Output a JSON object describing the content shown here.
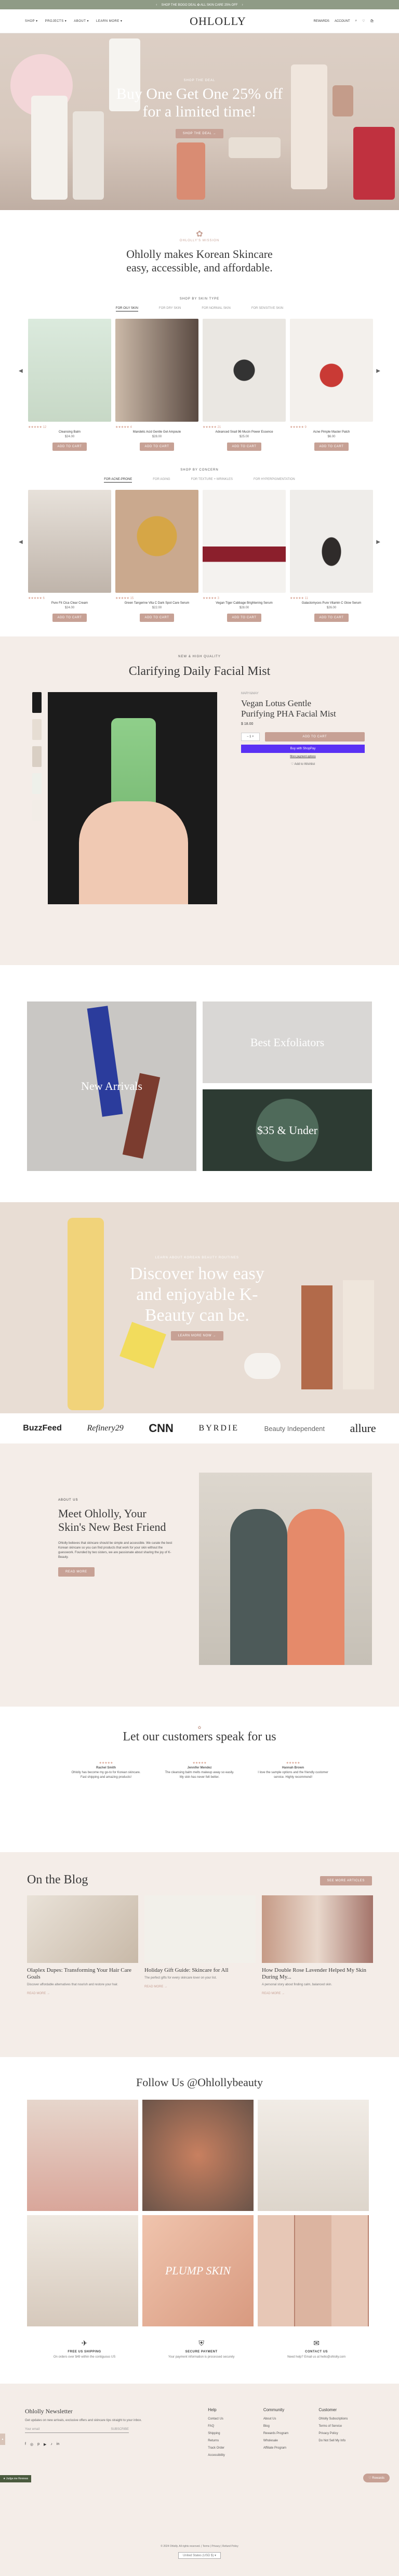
{
  "announcement": {
    "text": "SHOP THE BOGO DEAL  ✿  ALL SKIN CARE 25% OFF",
    "prev": "‹",
    "next": "›"
  },
  "header": {
    "logo": "OHLOLLY",
    "nav": [
      "SHOP ▾",
      "PROJECTS ▾",
      "ABOUT ▾",
      "LEARN MORE ▾"
    ],
    "right": [
      "REWARDS",
      "ACCOUNT",
      "⌕",
      "♡",
      "🛍"
    ]
  },
  "hero": {
    "eyebrow": "SHOP THE DEAL",
    "title_line1": "Buy One Get One 25% off",
    "title_line2": "for a limited time!",
    "cta": "SHOP THE DEAL →"
  },
  "mission": {
    "eyebrow": "OHLOLLY'S MISSION",
    "title_line1": "Ohlolly makes Korean Skincare",
    "title_line2": "easy, accessible, and affordable."
  },
  "skin_type": {
    "eyebrow": "SHOP BY SKIN TYPE",
    "tabs": [
      "FOR OILY SKIN",
      "FOR DRY SKIN",
      "FOR NORMAL SKIN",
      "FOR SENSITIVE SKIN"
    ],
    "products": [
      {
        "name": "Cleansing Balm",
        "price": "$24.00",
        "cta": "ADD TO CART",
        "stars": "★★★★★  12"
      },
      {
        "name": "Mandelic Acid Gentle Gel Ampoule",
        "price": "$28.00",
        "cta": "ADD TO CART",
        "stars": "★★★★★  4"
      },
      {
        "name": "Advanced Snail 96 Mucin Power Essence",
        "price": "$25.00",
        "cta": "ADD TO CART",
        "stars": "★★★★★  21"
      },
      {
        "name": "Acne Pimple Master Patch",
        "price": "$6.00",
        "cta": "ADD TO CART",
        "stars": "★★★★★  9"
      }
    ]
  },
  "concern": {
    "eyebrow": "SHOP BY CONCERN",
    "tabs": [
      "FOR ACNE-PRONE",
      "FOR AGING",
      "FOR TEXTURE + WRINKLES",
      "FOR HYPERPIGMENTATION"
    ],
    "products": [
      {
        "name": "Pure Fit Cica Clear Cream",
        "price": "$24.00",
        "cta": "ADD TO CART",
        "stars": "★★★★★  6"
      },
      {
        "name": "Green Tangerine Vita C Dark Spot Care Serum",
        "price": "$22.00",
        "cta": "ADD TO CART",
        "stars": "★★★★★  15"
      },
      {
        "name": "Vegan Tiger Cabbage Brightening Serum",
        "price": "$28.00",
        "cta": "ADD TO CART",
        "stars": "★★★★★  3"
      },
      {
        "name": "Galactomyces Pure Vitamin C Glow Serum",
        "price": "$26.00",
        "cta": "ADD TO CART",
        "stars": "★★★★★  11"
      }
    ]
  },
  "featured": {
    "eyebrow": "NEW & HIGH QUALITY",
    "title": "Clarifying Daily Facial Mist",
    "brand": "MARY&MAY",
    "product_line1": "Vegan Lotus Gentle",
    "product_line2": "Purifying PHA Facial Mist",
    "price": "$ 18.00",
    "qty": "1",
    "cta": "ADD TO CART",
    "pay": "Buy with ShopPay",
    "more": "More payment options",
    "wishlist": "♡ Add to Wishlist"
  },
  "categories": {
    "new": "New Arrivals",
    "exfoliators": "Best Exfoliators",
    "under": "$35 & Under"
  },
  "kbeauty": {
    "eyebrow": "LEARN ABOUT KOREAN BEAUTY ROUTINES",
    "title_line1": "Discover how easy",
    "title_line2": "and enjoyable K-",
    "title_line3": "Beauty can be.",
    "cta": "LEARN MORE NOW →"
  },
  "press": [
    "BuzzFeed",
    "Refinery29",
    "CNN",
    "BYRDIE",
    "Beauty Independent",
    "allure"
  ],
  "about": {
    "eyebrow": "ABOUT US",
    "title_line1": "Meet Ohlolly, Your",
    "title_line2": "Skin's New Best Friend",
    "body": "Ohlolly believes that skincare should be simple and accessible. We curate the best Korean skincare so you can find products that work for your skin without the guesswork. Founded by two sisters, we are passionate about sharing the joy of K-Beauty.",
    "cta": "READ MORE"
  },
  "testimonials": {
    "title": "Let our customers speak for us",
    "items": [
      {
        "name": "Rachel Smith",
        "text": "Ohlolly has become my go-to for Korean skincare. Fast shipping and amazing products!"
      },
      {
        "name": "Jennifer Mendez",
        "text": "The cleansing balm melts makeup away so easily. My skin has never felt better."
      },
      {
        "name": "Hannah Brown",
        "text": "I love the sample options and the friendly customer service. Highly recommend!"
      }
    ]
  },
  "blog": {
    "title": "On the Blog",
    "cta": "SEE MORE ARTICLES",
    "posts": [
      {
        "title": "Olaplex Dupes: Transforming Your Hair Care Goals",
        "excerpt": "Discover affordable alternatives that nourish and restore your hair.",
        "link": "READ MORE →"
      },
      {
        "title": "Holiday Gift Guide: Skincare for All",
        "excerpt": "The perfect gifts for every skincare lover on your list.",
        "link": "READ MORE →"
      },
      {
        "title": "How Double Rose Lavender Helped My Skin During My...",
        "excerpt": "A personal story about finding calm, balanced skin.",
        "link": "READ MORE →"
      }
    ]
  },
  "instagram": {
    "title": "Follow Us @Ohlollybeauty",
    "caption": "PLUMP SKIN"
  },
  "features": [
    {
      "icon": "✈",
      "title": "FREE US SHIPPING",
      "text": "On orders over $49 within the contiguous US"
    },
    {
      "icon": "⛨",
      "title": "SECURE PAYMENT",
      "text": "Your payment information is processed securely"
    },
    {
      "icon": "✉",
      "title": "CONTACT US",
      "text": "Need help? Email us at hello@ohlolly.com"
    }
  ],
  "footer": {
    "newsletter_title": "Ohlolly Newsletter",
    "newsletter_text": "Get updates on new arrivals, exclusive offers and skincare tips straight to your inbox.",
    "email_placeholder": "Your email",
    "subscribe": "SUBSCRIBE",
    "socials": [
      "f",
      "◎",
      "p",
      "▶",
      "♪",
      "in"
    ],
    "cols": [
      {
        "title": "Help",
        "items": [
          "Contact Us",
          "FAQ",
          "Shipping",
          "Returns",
          "Track Order",
          "Accessibility"
        ]
      },
      {
        "title": "Community",
        "items": [
          "About Us",
          "Blog",
          "Rewards Program",
          "Wholesale",
          "Affiliate Program"
        ]
      },
      {
        "title": "Customer",
        "items": [
          "Ohlolly Subscriptions",
          "Terms of Service",
          "Privacy Policy",
          "Do Not Sell My Info"
        ]
      }
    ],
    "currency": "United States (USD $) ▾",
    "copyright": "© 2024 Ohlolly. All rights reserved.  |  Terms  |  Privacy  |  Refund Policy",
    "reviews_tab": "★ Judge.me Reviews",
    "rewards": "♡ Rewards"
  }
}
